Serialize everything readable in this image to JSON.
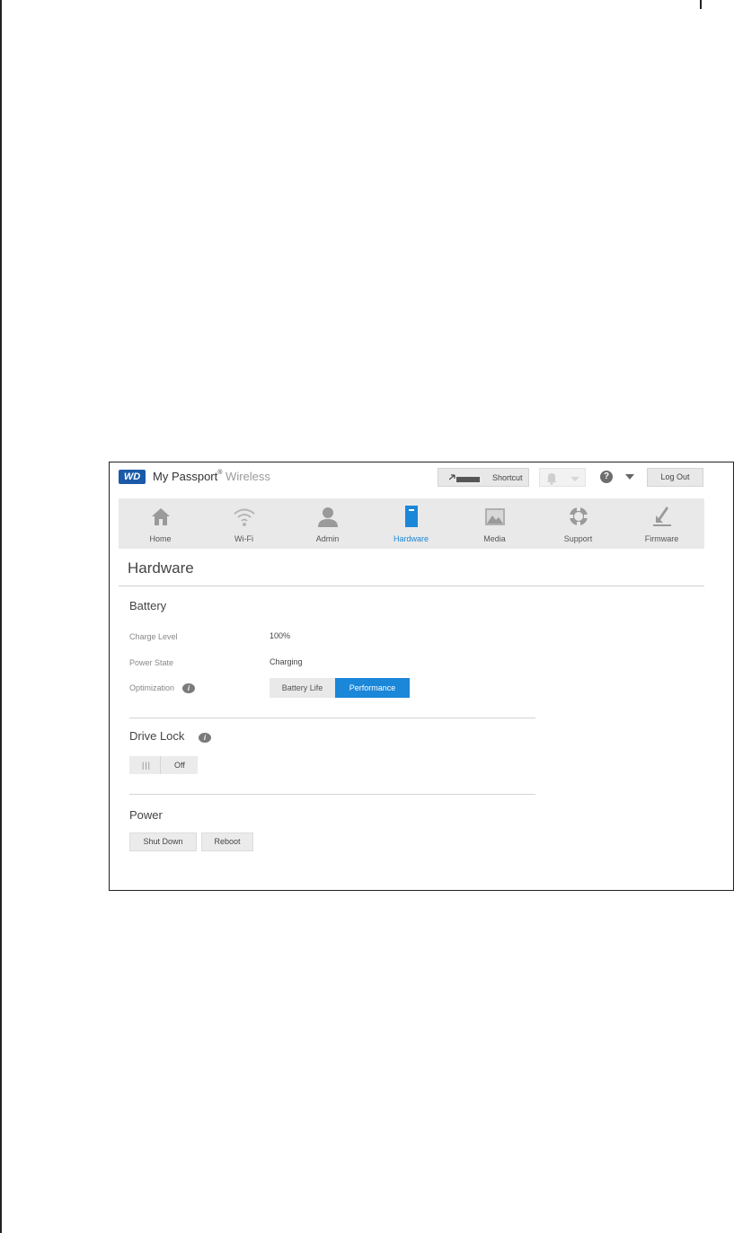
{
  "header": {
    "logo": "WD",
    "brand_name": "My Passport",
    "brand_reg": "®",
    "brand_suffix": "Wireless",
    "shortcut_label": "Shortcut",
    "logout_label": "Log Out",
    "help_glyph": "?"
  },
  "nav": {
    "items": [
      {
        "label": "Home",
        "icon": "home-icon"
      },
      {
        "label": "Wi-Fi",
        "icon": "wifi-icon"
      },
      {
        "label": "Admin",
        "icon": "user-icon"
      },
      {
        "label": "Hardware",
        "icon": "drive-icon"
      },
      {
        "label": "Media",
        "icon": "image-icon"
      },
      {
        "label": "Support",
        "icon": "lifebuoy-icon"
      },
      {
        "label": "Firmware",
        "icon": "download-icon"
      }
    ],
    "active": "Hardware",
    "active_color": "#1a87d8"
  },
  "page": {
    "title": "Hardware"
  },
  "battery": {
    "heading": "Battery",
    "charge_label": "Charge Level",
    "charge_value": "100%",
    "state_label": "Power State",
    "state_value": "Charging",
    "optimization_label": "Optimization",
    "option_battery": "Battery Life",
    "option_performance": "Performance",
    "selected": "Performance"
  },
  "drive_lock": {
    "heading": "Drive Lock",
    "toggle_grip": "|||",
    "toggle_state": "Off"
  },
  "power": {
    "heading": "Power",
    "shutdown_label": "Shut Down",
    "reboot_label": "Reboot"
  },
  "info_glyph": "i"
}
